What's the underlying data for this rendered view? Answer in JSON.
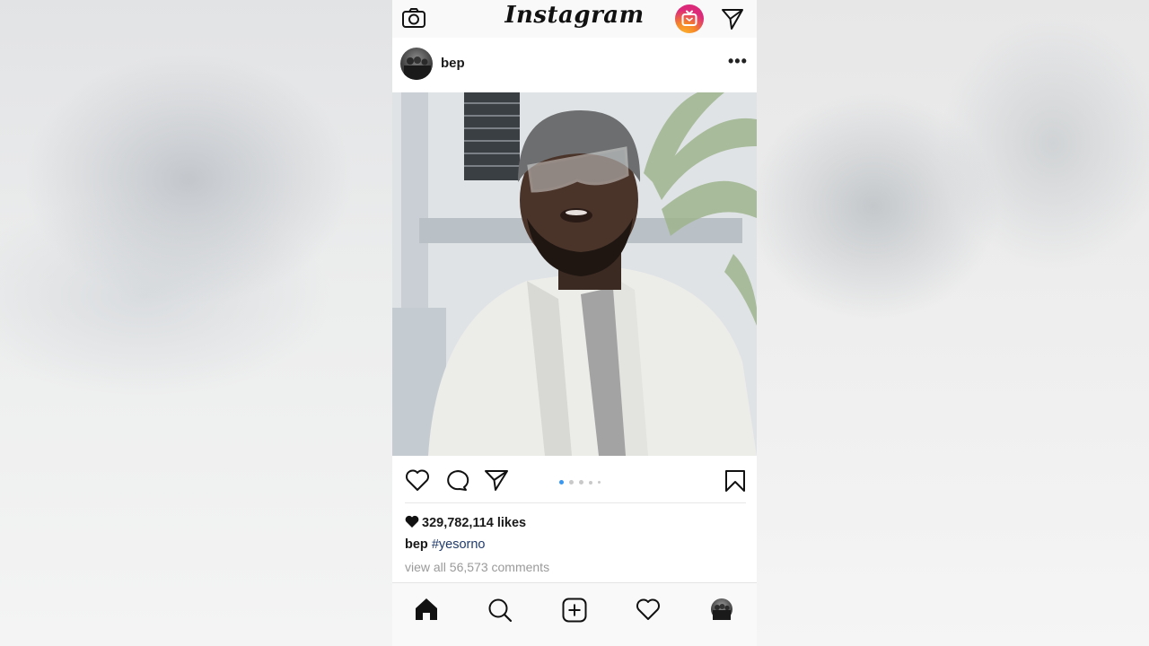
{
  "app": {
    "logo_text": "Instagram"
  },
  "top_bar": {
    "left_icon": "camera-icon",
    "right_icons": [
      "igtv-icon",
      "direct-message-icon"
    ],
    "igtv_gradient": [
      "#fdbb2d",
      "#f58529",
      "#dd2a7b"
    ]
  },
  "post": {
    "username": "bep",
    "more_label": "•••",
    "media_description_icon": "video-post",
    "carousel": {
      "count": 5,
      "active_index": 0,
      "active_color": "#3897f0",
      "inactive_color": "#c9c9c9"
    },
    "likes_text": "329,782,114 likes",
    "caption_user": "bep",
    "caption_text": "#yesorno",
    "comments_text": "view all 56,573 comments"
  },
  "actions": {
    "icons": [
      "heart-icon",
      "comment-icon",
      "share-icon",
      "bookmark-icon"
    ]
  },
  "bottom_nav": {
    "items": [
      "home-icon",
      "search-icon",
      "add-post-icon",
      "activity-heart-icon",
      "profile-icon"
    ],
    "active": "home-icon"
  }
}
